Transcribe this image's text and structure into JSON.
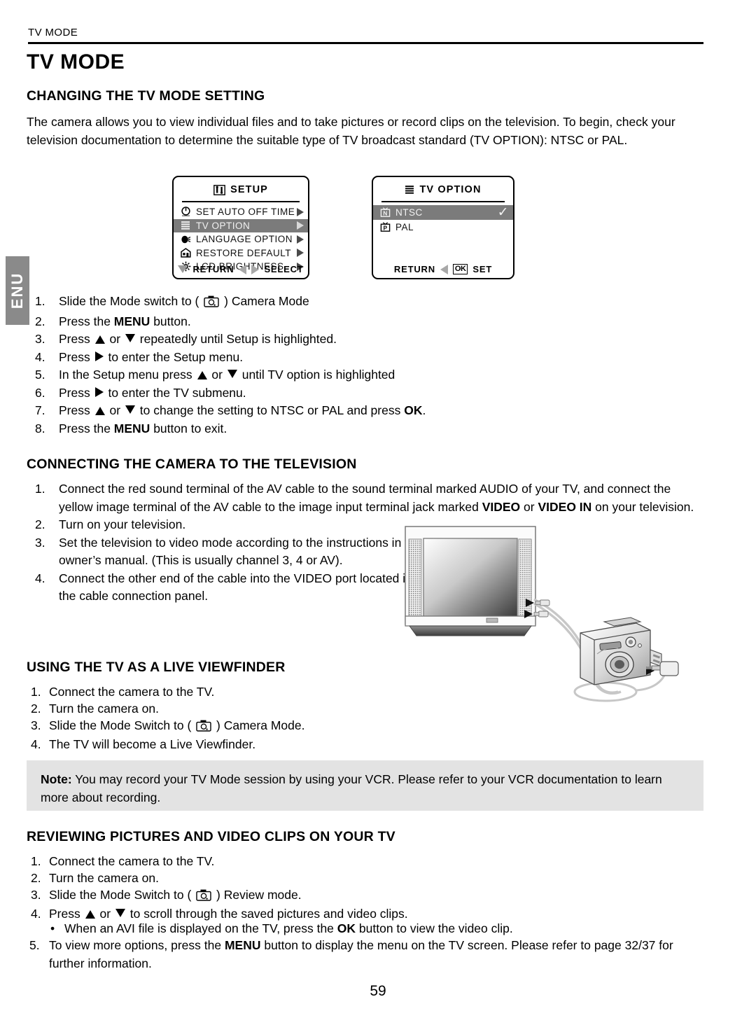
{
  "document": {
    "running_head": "TV MODE",
    "title": "TV MODE",
    "page_number": "59",
    "side_tab": "ENU"
  },
  "section_tv_mode_setting": {
    "heading": "CHANGING THE TV MODE SETTING",
    "intro": "The camera allows you to view individual files and to take pictures or record clips on the television. To begin, check your television documentation to determine the suitable type of TV broadcast standard (TV OPTION): NTSC or PAL.",
    "steps": [
      {
        "num": "1.",
        "pre": "Slide the Mode switch to (",
        "icon": "camera-mode-icon",
        "post": ") Camera Mode"
      },
      {
        "num": "2.",
        "pre": "Press the ",
        "bold": "MENU",
        "post": " button."
      },
      {
        "num": "3.",
        "pre": "Press ",
        "icon1": "up-triangle",
        "mid": " or ",
        "icon2": "down-triangle",
        "post": " repeatedly until Setup is highlighted."
      },
      {
        "num": "4.",
        "pre": "Press ",
        "icon1": "right-triangle",
        "post": " to enter the Setup menu."
      },
      {
        "num": "5.",
        "pre": "In the Setup menu press ",
        "icon1": "up-triangle",
        "mid": " or ",
        "icon2": "down-triangle",
        "post": " until TV option is highlighted"
      },
      {
        "num": "6.",
        "pre": "Press ",
        "icon1": "right-triangle",
        "post": " to enter the TV submenu."
      },
      {
        "num": "7.",
        "pre": "Press ",
        "icon1": "up-triangle",
        "mid": " or ",
        "icon2": "down-triangle",
        "post": " to change the setting to NTSC or PAL and press ",
        "bold": "OK",
        "tail": "."
      },
      {
        "num": "8.",
        "pre": "Press the ",
        "bold": "MENU",
        "post": " button to exit."
      }
    ]
  },
  "setup_menu": {
    "title": "SETUP",
    "title_icon": "setup-tool-icon",
    "items": [
      {
        "icon": "auto-off-clock-icon",
        "label": "SET AUTO OFF TIME",
        "arrow": "right-arrow",
        "selected": false
      },
      {
        "icon": "list-lines-icon",
        "label": "TV OPTION",
        "arrow": "right-arrow",
        "selected": true
      },
      {
        "icon": "language-globe-icon",
        "label": "LANGUAGE OPTION",
        "arrow": "right-arrow",
        "selected": false
      },
      {
        "icon": "restore-home-icon",
        "label": "RESTORE DEFAULT",
        "arrow": "right-arrow",
        "selected": false
      },
      {
        "icon": "brightness-sun-icon",
        "label": "LCD BRIGHTNESS",
        "arrow": "right-arrow",
        "selected": false
      }
    ],
    "footer": {
      "return_label": "RETURN",
      "select_label": "SELECT"
    }
  },
  "tv_option_menu": {
    "title": "TV OPTION",
    "title_icon": "list-lines-icon",
    "items": [
      {
        "icon": "tv-n-icon",
        "label": "NTSC",
        "selected": true,
        "checked": true
      },
      {
        "icon": "tv-p-icon",
        "label": "PAL",
        "selected": false,
        "checked": false
      }
    ],
    "footer": {
      "return_label": "RETURN",
      "ok_label": "OK",
      "set_label": "SET"
    }
  },
  "section_connecting": {
    "heading": "CONNECTING THE CAMERA TO THE TELEVISION",
    "steps": [
      {
        "num": "1.",
        "pre": "Connect the red sound terminal of the AV cable to the sound terminal marked AUDIO of your TV, and connect the yellow image terminal of the AV cable to the image input terminal jack marked ",
        "bold": "VIDEO",
        "mid": " or ",
        "bold2": "VIDEO IN",
        "post": " on your television."
      },
      {
        "num": "2.",
        "pre": "Turn on your television."
      },
      {
        "num": "3.",
        "pre": "Set the television to video mode according to the instructions in the owner’s manual. (This is usually channel 3, 4 or AV)."
      },
      {
        "num": "4.",
        "pre": "Connect the other end of the cable into the VIDEO port located in the cable connection panel."
      }
    ],
    "illustration": "tv-and-camera-av-cable-illustration"
  },
  "section_viewfinder": {
    "heading": "USING THE TV AS A LIVE VIEWFINDER",
    "steps": [
      {
        "num": "1.",
        "pre": "Connect the camera to the TV."
      },
      {
        "num": "2.",
        "pre": "Turn the camera on."
      },
      {
        "num": "3.",
        "pre": "Slide the Mode Switch to (",
        "icon": "camera-mode-icon",
        "post": ") Camera Mode."
      },
      {
        "num": "4.",
        "pre": "The TV will become a Live Viewfinder."
      }
    ]
  },
  "note": {
    "label": "Note:",
    "text": " You may record your TV Mode session by using your VCR. Please refer to your VCR documentation to learn more about recording."
  },
  "section_reviewing": {
    "heading": "REVIEWING PICTURES AND VIDEO CLIPS ON YOUR TV",
    "steps": [
      {
        "num": "1.",
        "pre": "Connect the camera to the TV."
      },
      {
        "num": "2.",
        "pre": "Turn the camera on."
      },
      {
        "num": "3.",
        "pre": "Slide the Mode Switch to (",
        "icon": "camera-mode-icon",
        "post": ") Review mode."
      },
      {
        "num": "4.",
        "pre": "Press ",
        "icon1": "up-triangle",
        "mid": " or ",
        "icon2": "down-triangle",
        "post": " to scroll through the saved pictures and video clips."
      }
    ],
    "sub_bullet": {
      "bullet": "•",
      "pre": "When an AVI file is displayed on the TV, press the ",
      "bold": "OK",
      "post": " button to view the video clip."
    },
    "step5": {
      "num": "5.",
      "pre": "To view more options, press the ",
      "bold": "MENU",
      "post": " button to display the menu on the TV screen. Please refer to page 32/37 for further information."
    }
  },
  "colors": {
    "selection_gray": "#7b7b7b",
    "note_background": "#e3e3e3",
    "side_tab_gray": "#8a8a8a"
  }
}
